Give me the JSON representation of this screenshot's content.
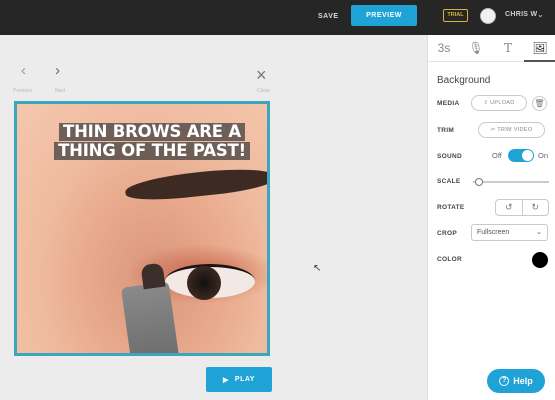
{
  "topbar": {
    "save_label": "SAVE",
    "preview_label": "PREVIEW",
    "trial_badge": "TRIAL",
    "user_name": "CHRIS W",
    "user_chevron": "⌄"
  },
  "canvas": {
    "prev_arrow": "‹",
    "prev_label": "Previous",
    "next_arrow": "›",
    "next_label": "Next",
    "close_glyph": "×",
    "close_label": "Close",
    "caption_line1": "THIN BROWS ARE A",
    "caption_line2": "THING OF THE PAST!",
    "play_label": "PLAY",
    "play_icon": "▶"
  },
  "panel": {
    "tabs": [
      {
        "label": "3s",
        "icon": "duration-icon"
      },
      {
        "label": "🎙",
        "icon": "microphone-icon"
      },
      {
        "label": "T",
        "icon": "text-icon"
      },
      {
        "label": "🖼",
        "icon": "image-icon"
      }
    ],
    "title": "Background",
    "media_label": "MEDIA",
    "upload_label": "⇪ UPLOAD",
    "delete_glyph": "🗑",
    "trim_label": "TRIM",
    "trim_video_label": "✂ TRIM VIDEO",
    "sound_label": "SOUND",
    "sound_off": "Off",
    "sound_on": "On",
    "scale_label": "SCALE",
    "scale_value": 0.05,
    "rotate_label": "ROTATE",
    "rotate_left": "↺",
    "rotate_right": "↻",
    "crop_label": "CROP",
    "crop_value": "Fullscreen",
    "crop_chevron": "⌄",
    "color_label": "COLOR",
    "color_value": "#000000"
  },
  "help": {
    "label": "Help",
    "icon": "?"
  },
  "colors": {
    "accent": "#1fa3d6",
    "frame": "#3aa7bf",
    "topbar": "#262626"
  }
}
